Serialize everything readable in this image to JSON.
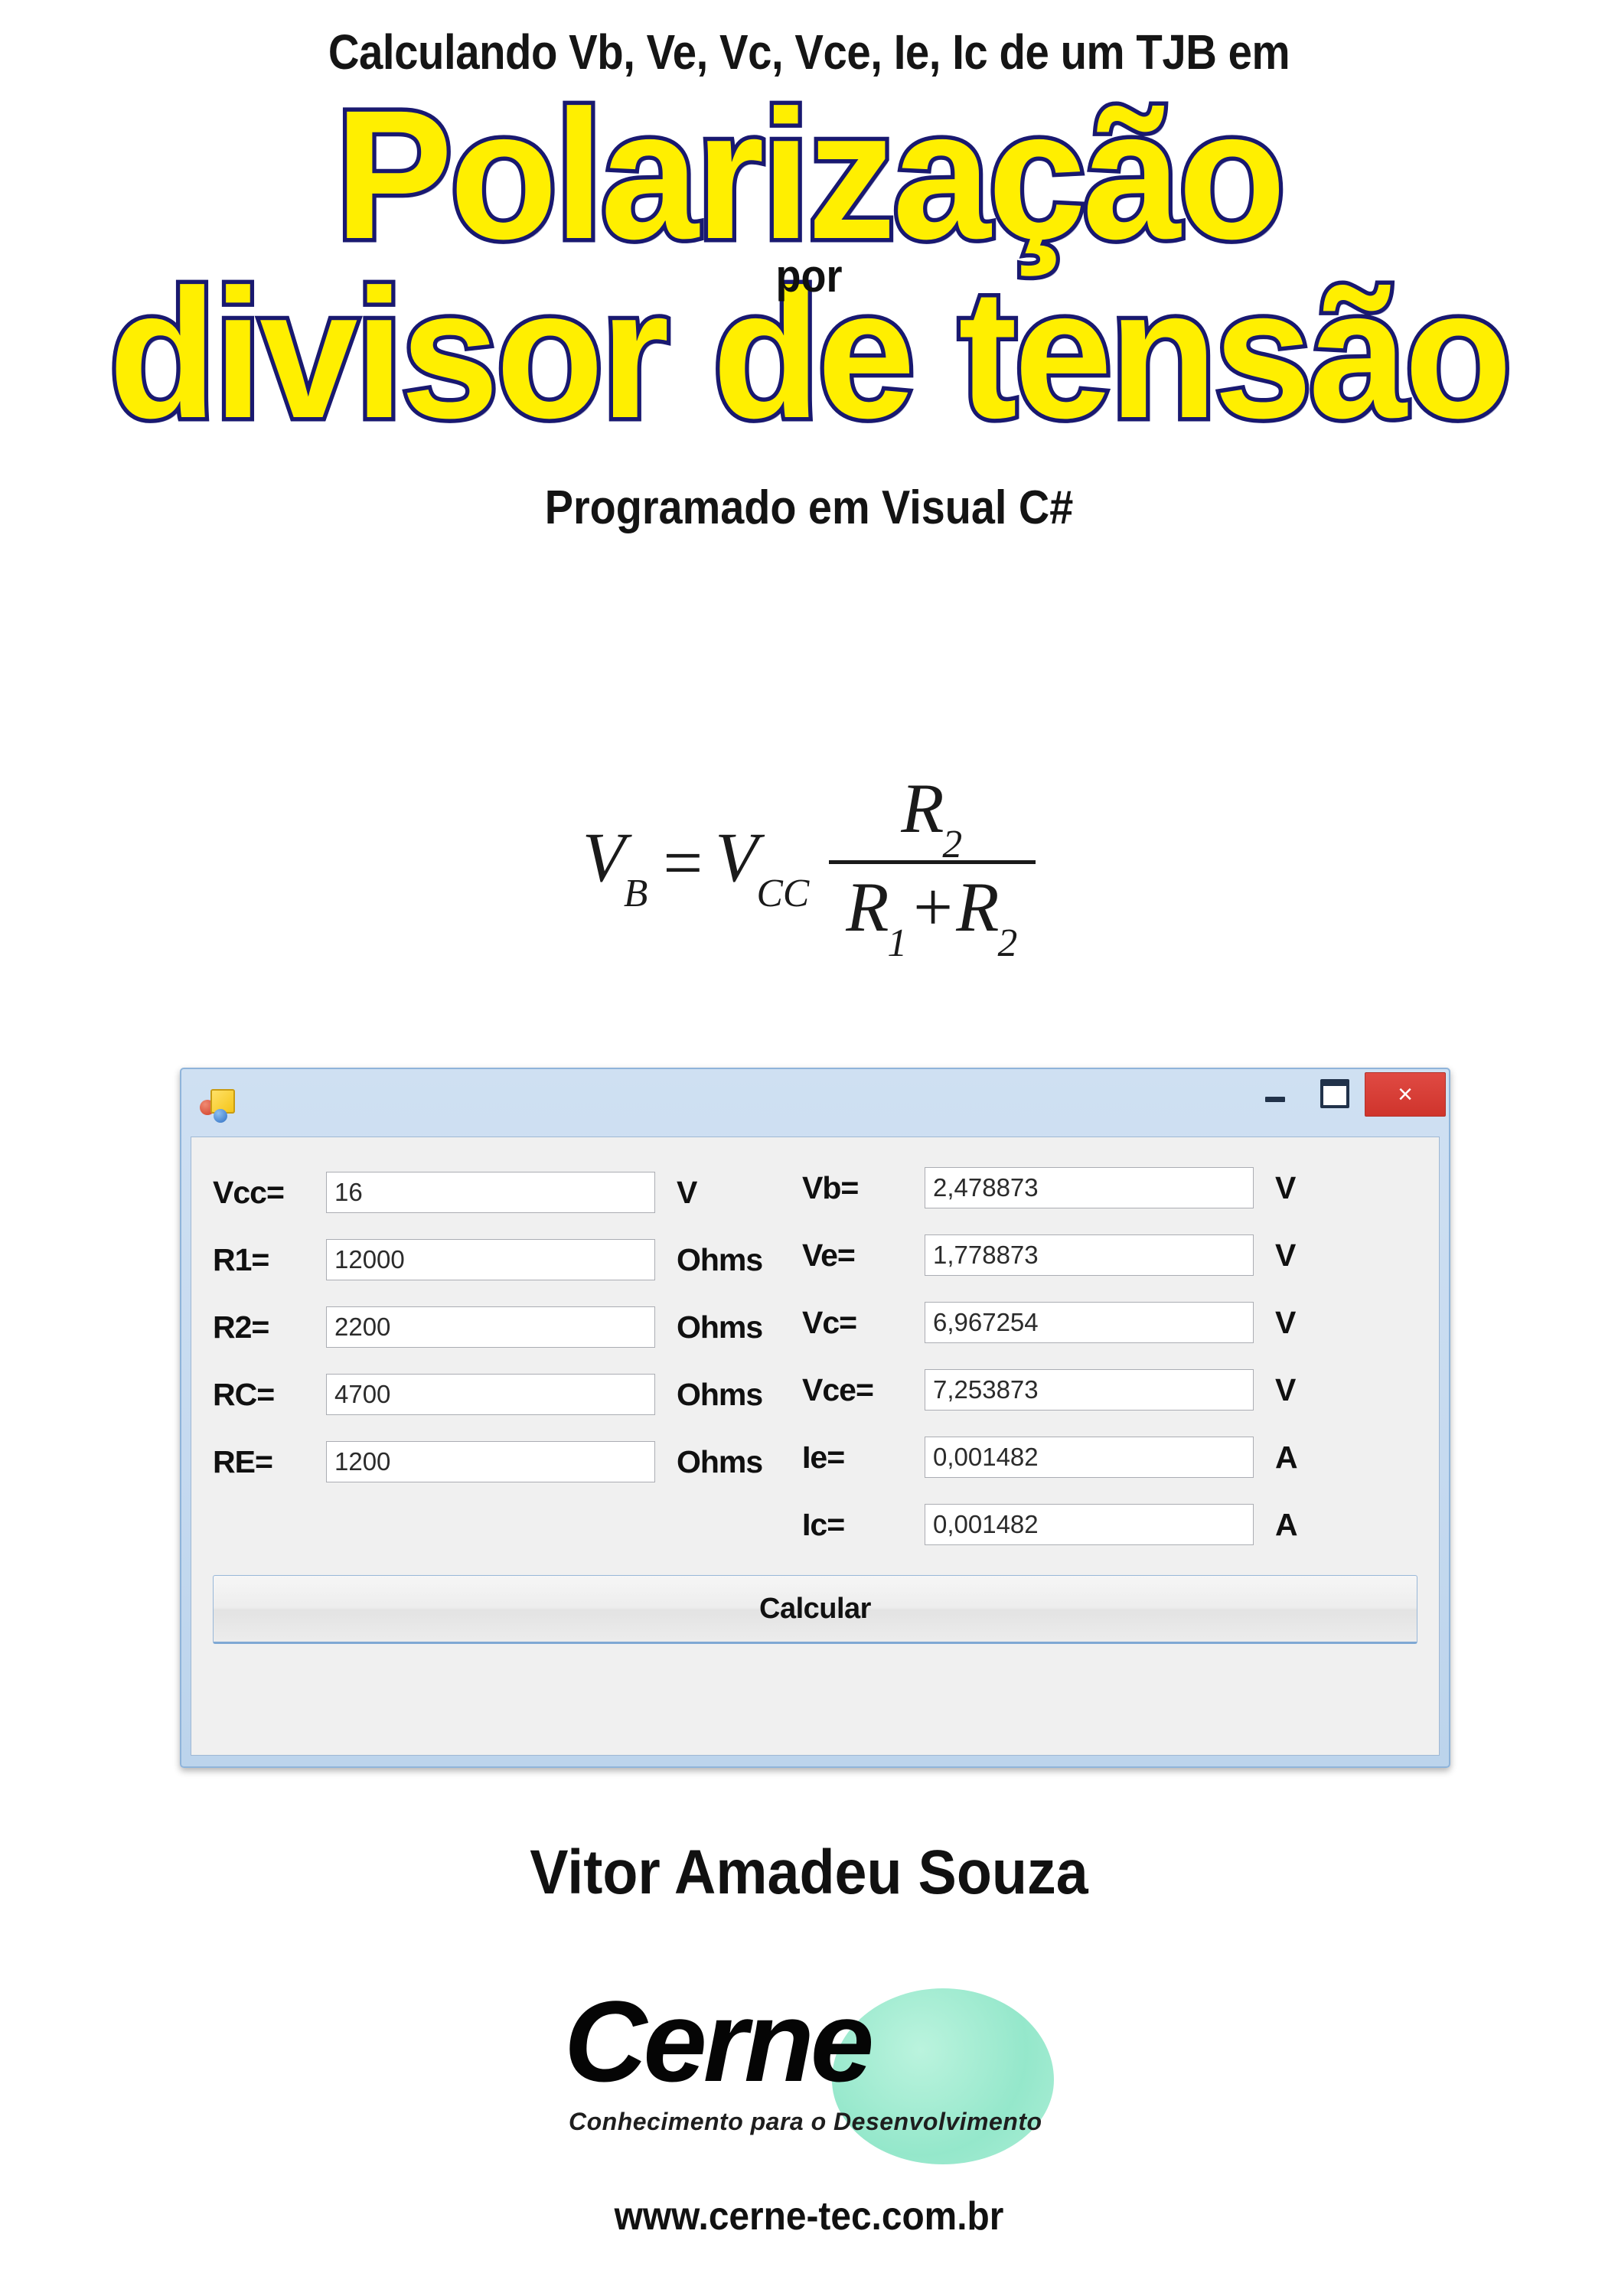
{
  "cover": {
    "kicker": "Calculando Vb, Ve, Vc, Vce, Ie, Ic de um TJB em",
    "title_line1": "Polarização",
    "title_overlay": "por",
    "title_line2": "divisor de tensão",
    "subtitle": "Programado em Visual C#",
    "title_fill_color": "#ffef00",
    "title_outline_color": "#191970"
  },
  "formula": {
    "lhs_var": "V",
    "lhs_sub": "B",
    "equals": "=",
    "rhs_var": "V",
    "rhs_sub": "CC",
    "numerator_var": "R",
    "numerator_sub": "2",
    "denominator": "R",
    "denominator_sub1": "1",
    "denominator_plus": "+R",
    "denominator_sub2": "2"
  },
  "window": {
    "title": "",
    "icon": "visual-studio-form-icon",
    "minimize_label": "",
    "maximize_label": "",
    "close_label": "×",
    "inputs": [
      {
        "label": "Vcc=",
        "value": "16",
        "unit": "V"
      },
      {
        "label": "R1=",
        "value": "12000",
        "unit": "Ohms"
      },
      {
        "label": "R2=",
        "value": "2200",
        "unit": "Ohms"
      },
      {
        "label": "RC=",
        "value": "4700",
        "unit": "Ohms"
      },
      {
        "label": "RE=",
        "value": "1200",
        "unit": "Ohms"
      }
    ],
    "outputs": [
      {
        "label": "Vb=",
        "value": "2,478873",
        "unit": "V"
      },
      {
        "label": "Ve=",
        "value": "1,778873",
        "unit": "V"
      },
      {
        "label": "Vc=",
        "value": "6,967254",
        "unit": "V"
      },
      {
        "label": "Vce=",
        "value": "7,253873",
        "unit": "V"
      },
      {
        "label": "Ie=",
        "value": "0,001482",
        "unit": "A"
      },
      {
        "label": "Ic=",
        "value": "0,001482",
        "unit": "A"
      }
    ],
    "calculate_label": "Calcular"
  },
  "footer": {
    "author": "Vitor Amadeu Souza",
    "logo_word": "Cerne",
    "logo_tagline": "Conhecimento para o Desenvolvimento",
    "site": "www.cerne-tec.com.br",
    "logo_blob_color": "#8fe6c8"
  }
}
